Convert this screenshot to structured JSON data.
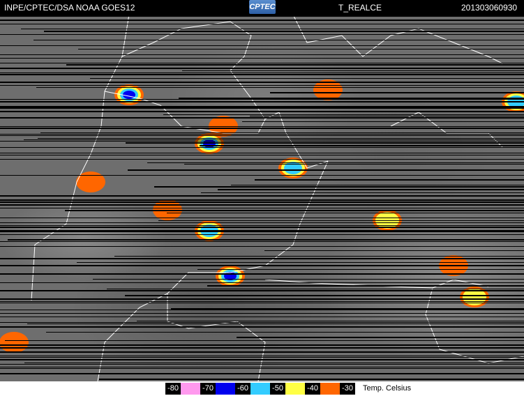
{
  "header": {
    "source": "INPE/CPTEC/DSA NOAA GOES12",
    "logo_text": "CPTEC",
    "product": "T_REALCE",
    "datetime": "201303060930"
  },
  "legend": {
    "labels": [
      "-80",
      "-70",
      "-60",
      "-50",
      "-40",
      "-30"
    ],
    "colors": [
      "#ff99ee",
      "#0000ee",
      "#33ccff",
      "#ffff44",
      "#ff6600"
    ],
    "unit": "Temp. Celsius"
  }
}
